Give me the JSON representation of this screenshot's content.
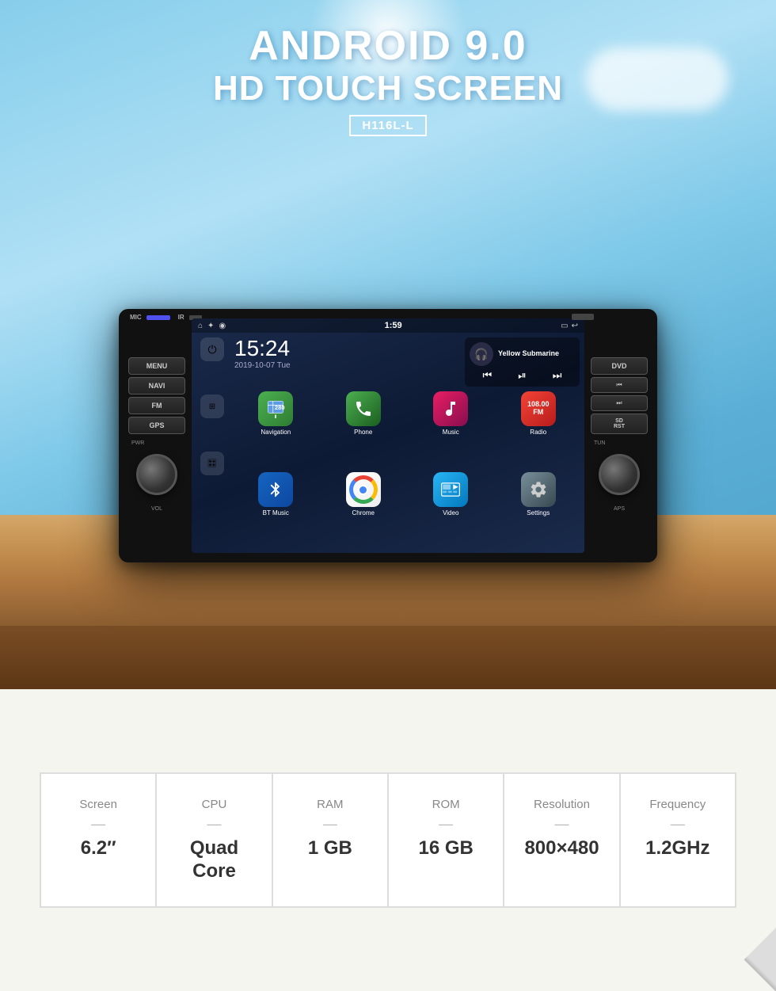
{
  "hero": {
    "title_line1": "ANDROID 9.0",
    "title_line2": "HD TOUCH SCREEN",
    "model": "H116L-L"
  },
  "device": {
    "left_buttons": [
      "MENU",
      "NAVI",
      "FM",
      "GPS"
    ],
    "right_buttons": [
      "DVD",
      "SD RST"
    ],
    "screen": {
      "status_bar": {
        "time": "1:59"
      },
      "clock": {
        "time": "15:24",
        "date": "2019-10-07  Tue"
      },
      "music": {
        "title": "Yellow Submarine",
        "icon": "🎧"
      },
      "apps": [
        {
          "name": "Navigation",
          "class": "app-navigation",
          "emoji": "🗺️"
        },
        {
          "name": "Phone",
          "class": "app-phone",
          "emoji": "📞"
        },
        {
          "name": "Music",
          "class": "app-music",
          "emoji": "🎵"
        },
        {
          "name": "Radio",
          "class": "app-radio",
          "emoji": "📻"
        },
        {
          "name": "BT Music",
          "class": "app-btmusic",
          "emoji": "🎵"
        },
        {
          "name": "Chrome",
          "class": "app-chrome",
          "emoji": "chrome"
        },
        {
          "name": "Video",
          "class": "app-video",
          "emoji": "🎬"
        },
        {
          "name": "Settings",
          "class": "app-settings",
          "emoji": "⚙️"
        }
      ]
    }
  },
  "specs": [
    {
      "label": "Screen",
      "value": "6.2″"
    },
    {
      "label": "CPU",
      "value": "Quad Core"
    },
    {
      "label": "RAM",
      "value": "1 GB"
    },
    {
      "label": "ROM",
      "value": "16 GB"
    },
    {
      "label": "Resolution",
      "value": "800×480"
    },
    {
      "label": "Frequency",
      "value": "1.2GHz"
    }
  ]
}
